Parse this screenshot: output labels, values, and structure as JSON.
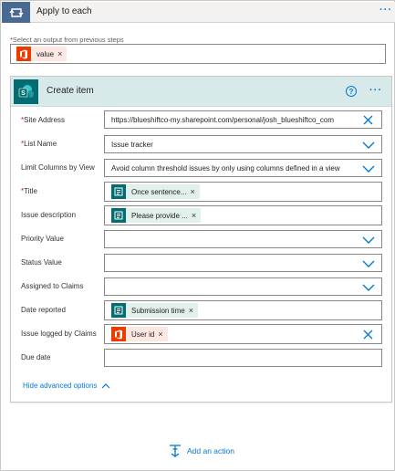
{
  "loop": {
    "title": "Apply to each",
    "more": "···"
  },
  "select_output": {
    "required_mark": "*",
    "label": "Select an output from previous steps",
    "token": {
      "label": "value",
      "remove": "×"
    }
  },
  "card": {
    "title": "Create item",
    "help": "?",
    "more": "···",
    "fields": {
      "site_address": {
        "required_mark": "*",
        "label": "Site Address",
        "value": "https://blueshiftco-my.sharepoint.com/personal/josh_blueshiftco_com"
      },
      "list_name": {
        "required_mark": "*",
        "label": "List Name",
        "value": "Issue tracker"
      },
      "limit_columns": {
        "label": "Limit Columns by View",
        "value": "Avoid column threshold issues by only using columns defined in a view"
      },
      "title": {
        "required_mark": "*",
        "label": "Title",
        "token": {
          "label": "Once sentence...",
          "remove": "×"
        }
      },
      "issue_description": {
        "label": "Issue description",
        "token": {
          "label": "Please provide ...",
          "remove": "×"
        }
      },
      "priority_value": {
        "label": "Priority Value",
        "value": ""
      },
      "status_value": {
        "label": "Status Value",
        "value": ""
      },
      "assigned_to": {
        "label": "Assigned to Claims",
        "value": ""
      },
      "date_reported": {
        "label": "Date reported",
        "token": {
          "label": "Submission time",
          "remove": "×"
        }
      },
      "issue_logged_by": {
        "label": "Issue logged by Claims",
        "token": {
          "label": "User id",
          "remove": "×"
        }
      },
      "due_date": {
        "label": "Due date",
        "value": ""
      }
    },
    "advanced_toggle": "Hide advanced options"
  },
  "add_action": {
    "label": "Add an action"
  },
  "colors": {
    "loop_accent": "#486991",
    "sharepoint": "#036c70",
    "office": "#eb3c00",
    "link": "#0078d4",
    "card_header": "#d7eae9"
  },
  "icons": {
    "loop": "loop-icon",
    "sharepoint": "sharepoint-icon",
    "office": "office-icon",
    "forms": "forms-icon"
  }
}
